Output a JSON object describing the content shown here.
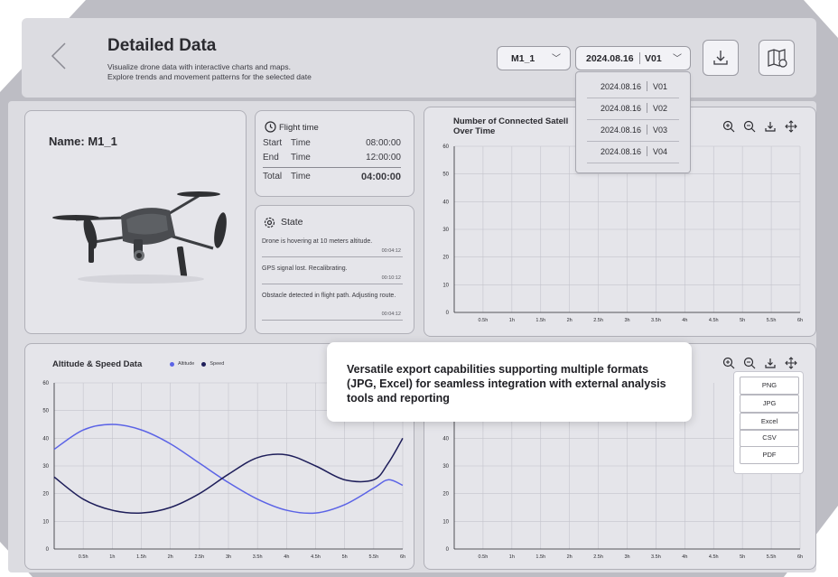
{
  "header": {
    "title": "Detailed Data",
    "subtitle_line1": "Visualize drone data with interactive charts and maps.",
    "subtitle_line2": "Explore trends and movement patterns for the selected date",
    "model_select": "M1_1",
    "date_select": "2024.08.16",
    "version_select": "V01"
  },
  "date_dropdown": [
    {
      "date": "2024.08.16",
      "version": "V01"
    },
    {
      "date": "2024.08.16",
      "version": "V02"
    },
    {
      "date": "2024.08.16",
      "version": "V03"
    },
    {
      "date": "2024.08.16",
      "version": "V04"
    }
  ],
  "drone": {
    "name": "Name: M1_1"
  },
  "flight_time": {
    "title": "Flight time",
    "start_label": "Start",
    "start_sub": "Time",
    "start_value": "08:00:00",
    "end_label": "End",
    "end_sub": "Time",
    "end_value": "12:00:00",
    "total_label": "Total",
    "total_sub": "Time",
    "total_value": "04:00:00"
  },
  "state": {
    "title": "State",
    "items": [
      {
        "text": "Drone is hovering at 10 meters altitude.",
        "time": "00:04:12"
      },
      {
        "text": "GPS signal lost. Recalibrating.",
        "time": "00:10:12"
      },
      {
        "text": "Obstacle detected in flight path. Adjusting route.",
        "time": "00:04:12"
      }
    ]
  },
  "satellite_chart": {
    "title_line1": "Number of Connected Satell",
    "title_line2": "Over Time"
  },
  "altitude_chart": {
    "title": "Altitude & Speed Data",
    "legend_altitude": "Altitude",
    "legend_speed": "Speed"
  },
  "tooltip": {
    "text": "Versatile export capabilities supporting multiple formats (JPG, Excel) for seamless integration with external analysis tools and reporting"
  },
  "export_menu": [
    "PNG",
    "JPG",
    "Excel",
    "CSV",
    "PDF"
  ],
  "colors": {
    "altitude": "#5b63e6",
    "speed": "#1e1e5a",
    "panel": "#e5e5ea",
    "frame": "#bdbdc4"
  },
  "chart_data": [
    {
      "type": "line",
      "x": [
        "0.5h",
        "1h",
        "1.5h",
        "2h",
        "2.5h",
        "3h",
        "3.5h",
        "4h",
        "4.5h",
        "5h",
        "5.5h",
        "6h"
      ],
      "yticks": [
        0,
        10,
        20,
        30,
        40,
        50,
        60
      ],
      "ylim": [
        0,
        60
      ],
      "series": []
    },
    {
      "type": "line",
      "title": "Altitude & Speed Data",
      "x": [
        "0.5h",
        "1h",
        "1.5h",
        "2h",
        "2.5h",
        "3h",
        "3.5h",
        "4h",
        "4.5h",
        "5h",
        "5.5h",
        "6h"
      ],
      "xvals": [
        0,
        0.5,
        1,
        1.5,
        2,
        2.5,
        3,
        3.5,
        4,
        4.5,
        5,
        5.5,
        6
      ],
      "yticks": [
        0,
        10,
        20,
        30,
        40,
        50,
        60
      ],
      "ylim": [
        0,
        60
      ],
      "series": [
        {
          "name": "Altitude",
          "values": [
            36,
            43,
            45,
            43,
            38,
            31,
            24,
            18,
            14,
            13,
            16,
            22,
            25,
            23
          ]
        },
        {
          "name": "Speed",
          "values": [
            26,
            18,
            14,
            13,
            15,
            20,
            27,
            33,
            34,
            30,
            25,
            25,
            31,
            40
          ]
        }
      ],
      "series_x": [
        0,
        0.5,
        1,
        1.5,
        2,
        2.5,
        3,
        3.5,
        4,
        4.5,
        5,
        5.5,
        5.75,
        6
      ]
    },
    {
      "type": "line",
      "x": [
        "0.5h",
        "1h",
        "1.5h",
        "2h",
        "2.5h",
        "3h",
        "3.5h",
        "4h",
        "4.5h",
        "5h",
        "5.5h",
        "6h"
      ],
      "yticks": [
        0,
        10,
        20,
        30,
        40
      ],
      "ylim": [
        0,
        60
      ],
      "series": []
    }
  ]
}
